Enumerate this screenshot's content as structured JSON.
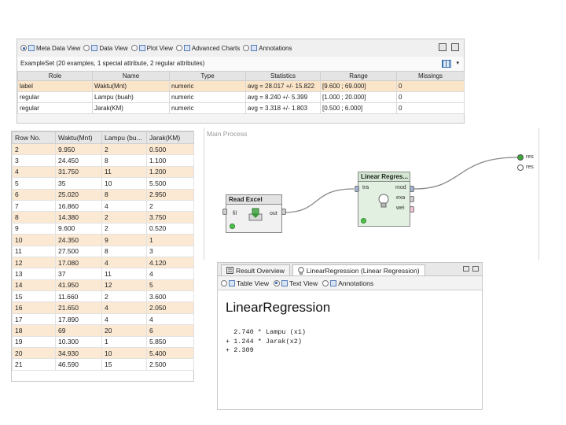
{
  "meta_view": {
    "tabs": [
      {
        "label": "Meta Data View",
        "selected": true
      },
      {
        "label": "Data View",
        "selected": false
      },
      {
        "label": "Plot View",
        "selected": false
      },
      {
        "label": "Advanced Charts",
        "selected": false
      },
      {
        "label": "Annotations",
        "selected": false
      }
    ],
    "summary": "ExampleSet (20 examples, 1 special attribute, 2 regular attributes)",
    "columns": [
      "Role",
      "Name",
      "Type",
      "Statistics",
      "Range",
      "Missings"
    ],
    "rows": [
      [
        "label",
        "Waktu(Mnt)",
        "numeric",
        "avg = 28.017 +/- 15.822",
        "[9.600 ; 69.000]",
        "0"
      ],
      [
        "regular",
        "Lampu (buah)",
        "numeric",
        "avg = 8.240 +/- 5.399",
        "[1.000 ; 20.000]",
        "0"
      ],
      [
        "regular",
        "Jarak(KM)",
        "numeric",
        "avg = 3.318 +/- 1.803",
        "[0.500 ; 6.000]",
        "0"
      ]
    ]
  },
  "data_table": {
    "columns": [
      "Row No.",
      "Waktu(Mnt)",
      "Lampu (bu...",
      "Jarak(KM)"
    ],
    "rows": [
      [
        "2",
        "9.950",
        "2",
        "0.500"
      ],
      [
        "3",
        "24.450",
        "8",
        "1.100"
      ],
      [
        "4",
        "31.750",
        "11",
        "1.200"
      ],
      [
        "5",
        "35",
        "10",
        "5.500"
      ],
      [
        "6",
        "25.020",
        "8",
        "2.950"
      ],
      [
        "7",
        "16.860",
        "4",
        "2"
      ],
      [
        "8",
        "14.380",
        "2",
        "3.750"
      ],
      [
        "9",
        "9.600",
        "2",
        "0.520"
      ],
      [
        "10",
        "24.350",
        "9",
        "1"
      ],
      [
        "11",
        "27.500",
        "8",
        "3"
      ],
      [
        "12",
        "17.080",
        "4",
        "4.120"
      ],
      [
        "13",
        "37",
        "11",
        "4"
      ],
      [
        "14",
        "41.950",
        "12",
        "5"
      ],
      [
        "15",
        "11.660",
        "2",
        "3.600"
      ],
      [
        "16",
        "21.650",
        "4",
        "2.050"
      ],
      [
        "17",
        "17.890",
        "4",
        "4"
      ],
      [
        "18",
        "69",
        "20",
        "6"
      ],
      [
        "19",
        "10.300",
        "1",
        "5.850"
      ],
      [
        "20",
        "34.930",
        "10",
        "5.400"
      ],
      [
        "21",
        "46.590",
        "15",
        "2.500"
      ]
    ]
  },
  "process": {
    "title": "Main Process",
    "read_excel": {
      "title": "Read Excel",
      "in_port": "fil",
      "out_port": "out"
    },
    "linear_regression": {
      "title": "Linear Regres...",
      "in_port": "tra",
      "out_ports": [
        "mod",
        "exa",
        "wei"
      ]
    },
    "result_ports": [
      "res",
      "res"
    ]
  },
  "result": {
    "tabs": [
      {
        "label": "Result Overview",
        "icon": "result-overview-icon"
      },
      {
        "label": "LinearRegression (Linear Regression)",
        "icon": "lightbulb-icon"
      }
    ],
    "views": [
      {
        "label": "Table View",
        "selected": false
      },
      {
        "label": "Text View",
        "selected": true
      },
      {
        "label": "Annotations",
        "selected": false
      }
    ],
    "title": "LinearRegression",
    "equation": [
      "  2.740 * Lampu (x1)",
      "+ 1.244 * Jarak(x2)",
      "+ 2.309"
    ]
  }
}
